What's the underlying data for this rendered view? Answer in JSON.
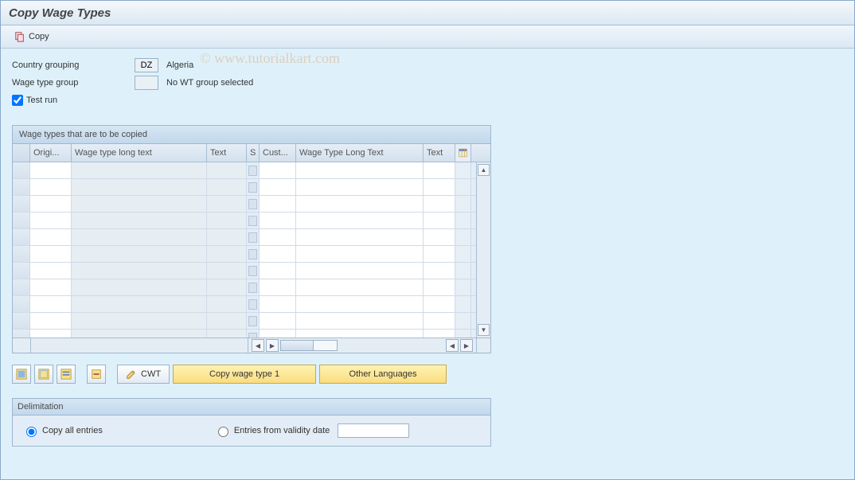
{
  "title": "Copy Wage Types",
  "watermark": "© www.tutorialkart.com",
  "toolbar": {
    "copy_label": "Copy"
  },
  "fields": {
    "country_grouping_label": "Country grouping",
    "country_grouping_value": "DZ",
    "country_grouping_text": "Algeria",
    "wage_type_group_label": "Wage type group",
    "wage_type_group_value": "",
    "wage_type_group_text": "No WT group selected",
    "test_run_label": "Test run",
    "test_run_checked": true
  },
  "table": {
    "title": "Wage types that are to be copied",
    "columns": {
      "origi": "Origi...",
      "longtext": "Wage type long text",
      "text": "Text",
      "s": "S",
      "cust": "Cust...",
      "longtext2": "Wage Type Long Text",
      "text2": "Text"
    },
    "row_count": 11
  },
  "buttons": {
    "cwt_label": "CWT",
    "copy_wt1_label": "Copy wage type 1",
    "other_lang_label": "Other Languages"
  },
  "delimitation": {
    "title": "Delimitation",
    "opt_all_label": "Copy all entries",
    "opt_from_label": "Entries from validity date",
    "selected": "all",
    "date_value": ""
  }
}
